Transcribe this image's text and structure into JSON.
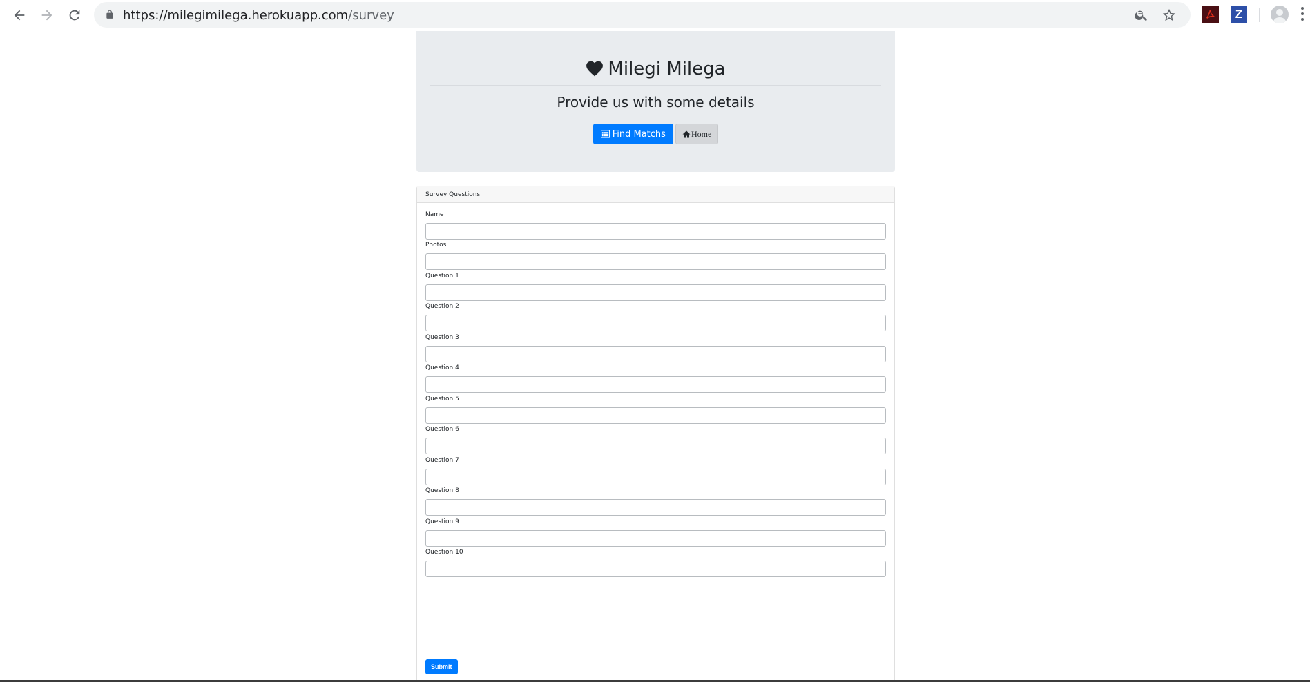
{
  "browser": {
    "url_host": "https://milegimilega.herokuapp.com",
    "url_path": "/survey",
    "icons": {
      "back": "arrow-left-icon",
      "forward": "arrow-right-icon",
      "reload": "reload-icon",
      "lock": "lock-icon",
      "zoom": "zoom-icon",
      "bookmark": "star-icon",
      "pdf_extension": "acrobat-pdf-icon",
      "z_extension": "z-extension-icon",
      "profile": "profile-avatar-icon",
      "menu": "kebab-menu-icon"
    },
    "z_extension_label": "Z"
  },
  "header": {
    "brand": "Milegi Milega",
    "brand_icon": "heart-icon",
    "subtitle": "Provide us with some details",
    "find_button": "Find Matchs",
    "find_button_icon": "list-alt-icon",
    "home_button": "Home",
    "home_button_icon": "home-icon"
  },
  "survey": {
    "title": "Survey Questions",
    "fields": [
      {
        "label": "Name",
        "value": ""
      },
      {
        "label": "Photos",
        "value": ""
      },
      {
        "label": "Question 1",
        "value": ""
      },
      {
        "label": "Question 2",
        "value": ""
      },
      {
        "label": "Question 3",
        "value": ""
      },
      {
        "label": "Question 4",
        "value": ""
      },
      {
        "label": "Question 5",
        "value": ""
      },
      {
        "label": "Question 6",
        "value": ""
      },
      {
        "label": "Question 7",
        "value": ""
      },
      {
        "label": "Question 8",
        "value": ""
      },
      {
        "label": "Question 9",
        "value": ""
      },
      {
        "label": "Question 10",
        "value": ""
      }
    ],
    "submit_label": "Submit"
  },
  "colors": {
    "primary": "#007bff",
    "jumbotron_bg": "#e9ecef",
    "text": "#212529"
  }
}
